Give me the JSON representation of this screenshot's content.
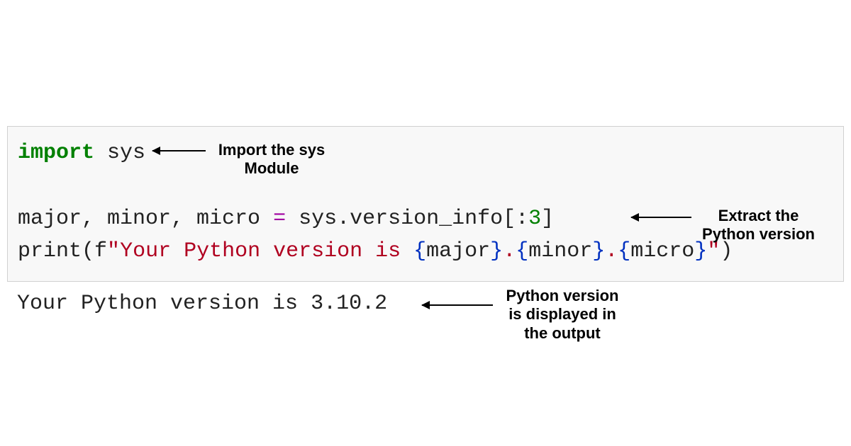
{
  "code": {
    "line1": {
      "kw": "import",
      "sp": " ",
      "mod": "sys"
    },
    "line2": {
      "vars": "major, minor, micro ",
      "eq": "=",
      "rest": " sys.version_info[:",
      "num": "3",
      "close": "]"
    },
    "line3": {
      "fn": "print",
      "open": "(",
      "prefix": "f",
      "q1": "\"",
      "txt": "Your Python version is ",
      "i1o": "{",
      "i1": "major",
      "i1c": "}",
      "dot1": ".",
      "i2o": "{",
      "i2": "minor",
      "i2c": "}",
      "dot2": ".",
      "i3o": "{",
      "i3": "micro",
      "i3c": "}",
      "q2": "\"",
      "close": ")"
    }
  },
  "output": "Your Python version is 3.10.2",
  "annotations": {
    "a1_l1": "Import the sys",
    "a1_l2": "Module",
    "a2_l1": "Extract the",
    "a2_l2": "Python version",
    "a3_l1": "Python version",
    "a3_l2": "is displayed in",
    "a3_l3": "the output"
  }
}
